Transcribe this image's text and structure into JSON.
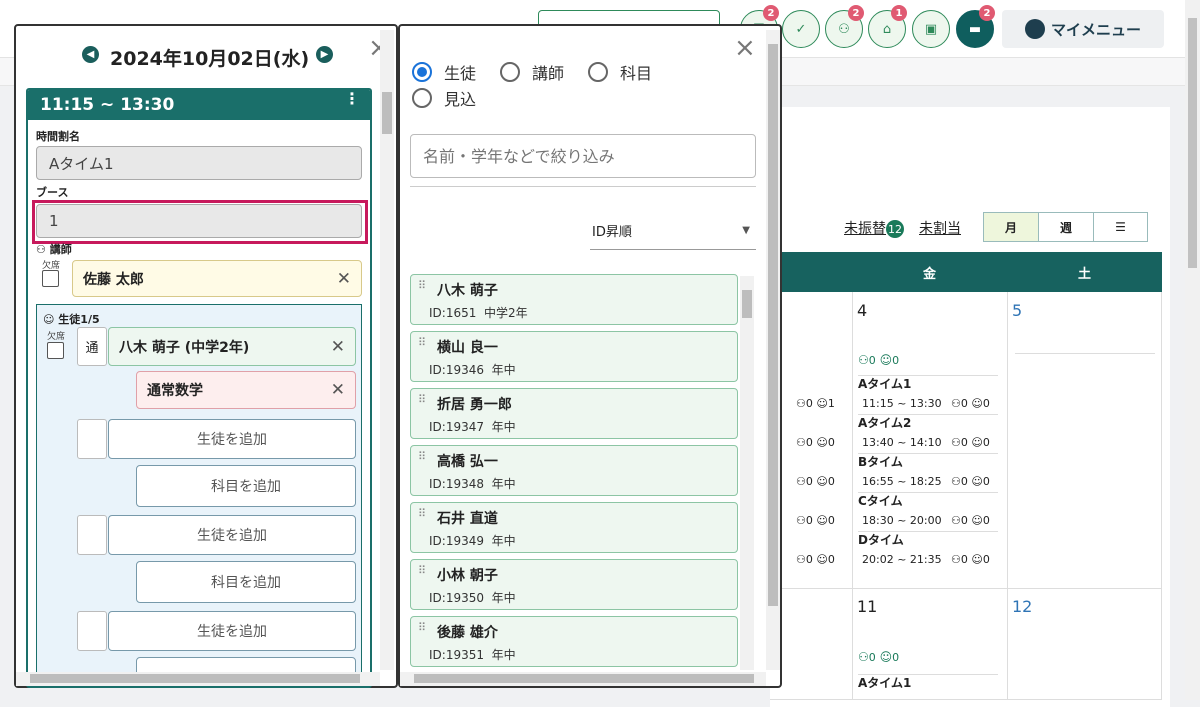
{
  "header": {
    "mymenu_label": "マイメニュー",
    "icons": [
      {
        "name": "notice-icon",
        "badge": "2"
      },
      {
        "name": "checklist-icon",
        "badge": ""
      },
      {
        "name": "group-icon",
        "badge": "2"
      },
      {
        "name": "school-icon",
        "badge": "1"
      },
      {
        "name": "gift-icon",
        "badge": ""
      },
      {
        "name": "chat-icon",
        "badge": "2"
      }
    ]
  },
  "calendar": {
    "unassigned_label": "未振替",
    "unassigned_count": "12",
    "unallocated_label": "未割当",
    "view_month": "月",
    "view_week": "週",
    "days": [
      "金",
      "土"
    ],
    "cells": {
      "fri_date": "4",
      "sat_date": "5",
      "fri2_date": "11",
      "sat2_date": "12"
    },
    "counts": "0",
    "slots": [
      {
        "name": "Aタイム1",
        "time": "11:15 ~ 13:30",
        "t": "0",
        "s": "0"
      },
      {
        "name": "Aタイム2",
        "time": "13:40 ~ 14:10",
        "t": "0",
        "s": "0"
      },
      {
        "name": "Bタイム",
        "time": "16:55 ~ 18:25",
        "t": "0",
        "s": "0"
      },
      {
        "name": "Cタイム",
        "time": "18:30 ~ 20:00",
        "t": "0",
        "s": "0"
      },
      {
        "name": "Dタイム",
        "time": "20:02 ~ 21:35",
        "t": "0",
        "s": "0"
      }
    ],
    "thu_counts": [
      "1",
      "0",
      "0",
      "0",
      "0"
    ],
    "next_slot_name": "Aタイム1"
  },
  "left_panel": {
    "date": "2024年10月02日(水)",
    "slot_header": "11:15 ~ 13:30",
    "timetable_label": "時間割名",
    "timetable_value": "Aタイム1",
    "booth_label": "ブース",
    "booth_value": "1",
    "teacher_label": "講師",
    "absent_label": "欠席",
    "teacher_name": "佐藤 太郎",
    "students_label": "生徒1/5",
    "type_label": "通",
    "student_name": "八木 萌子 (中学2年)",
    "subject_name": "通常数学",
    "add_student": "生徒を追加",
    "add_subject": "科目を追加"
  },
  "right_panel": {
    "filters": [
      "生徒",
      "講師",
      "科目",
      "見込"
    ],
    "search_placeholder": "名前・学年などで絞り込み",
    "sort_label": "ID昇順",
    "students": [
      {
        "name": "八木 萌子",
        "id": "ID:1651",
        "grade": "中学2年"
      },
      {
        "name": "横山 良一",
        "id": "ID:19346",
        "grade": "年中"
      },
      {
        "name": "折居 勇一郎",
        "id": "ID:19347",
        "grade": "年中"
      },
      {
        "name": "高橋 弘一",
        "id": "ID:19348",
        "grade": "年中"
      },
      {
        "name": "石井 直道",
        "id": "ID:19349",
        "grade": "年中"
      },
      {
        "name": "小林 朝子",
        "id": "ID:19350",
        "grade": "年中"
      },
      {
        "name": "後藤 雄介",
        "id": "ID:19351",
        "grade": "年中"
      }
    ]
  }
}
